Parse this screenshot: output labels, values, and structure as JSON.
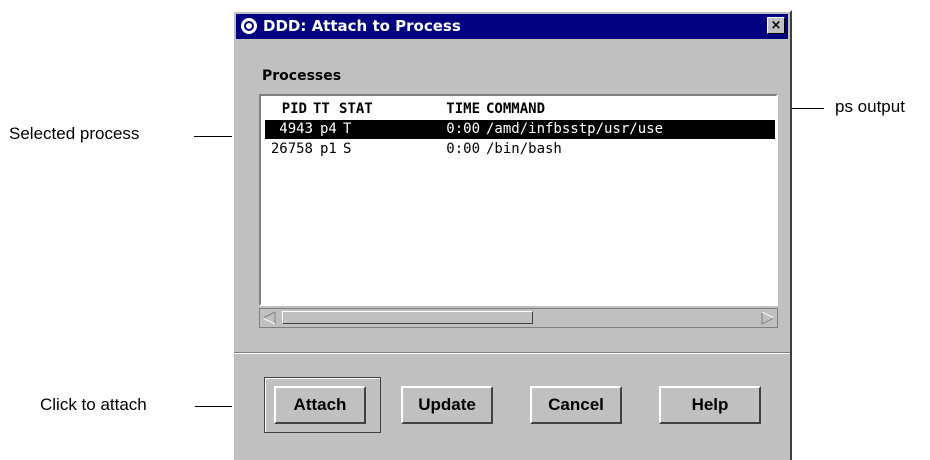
{
  "window": {
    "title": "DDD: Attach to Process",
    "close_label": "×"
  },
  "processes": {
    "label": "Processes",
    "columns": {
      "pid": "PID",
      "tt": "TT",
      "stat": "STAT",
      "time": "TIME",
      "command": "COMMAND"
    },
    "rows": [
      {
        "pid": "4943",
        "tt": "p4",
        "stat": "T",
        "time": "0:00",
        "command": "/amd/infbsstp/usr/use",
        "selected": true
      },
      {
        "pid": "26758",
        "tt": "p1",
        "stat": "S",
        "time": "0:00",
        "command": "/bin/bash",
        "selected": false
      }
    ]
  },
  "buttons": {
    "attach": "Attach",
    "update": "Update",
    "cancel": "Cancel",
    "help": "Help"
  },
  "annotations": {
    "selected_process": "Selected process",
    "ps_output": "ps output",
    "click_to_attach": "Click to attach"
  },
  "colors": {
    "titlebar": "#000080",
    "window_bg": "#c0c0c0",
    "selection_bg": "#000000"
  }
}
